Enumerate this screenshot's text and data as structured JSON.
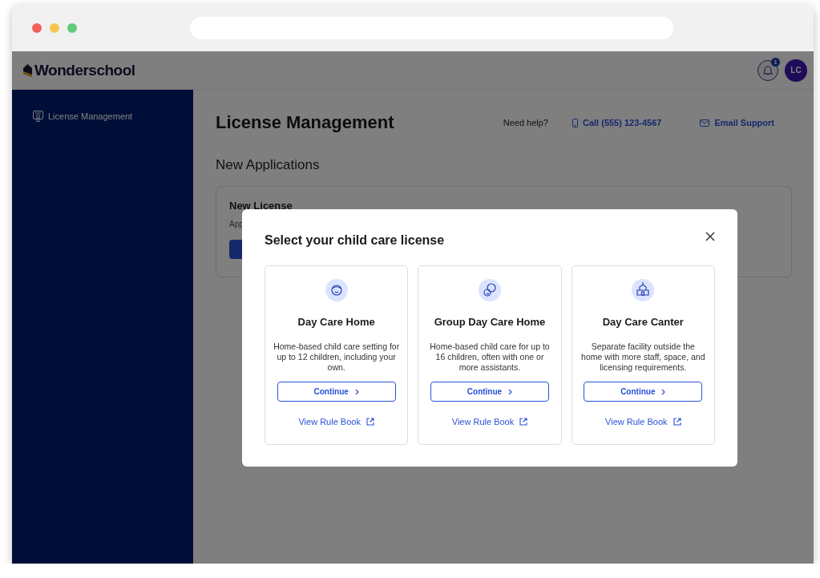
{
  "app_header": {
    "logo": "Wonderschool",
    "notifications": {
      "count": "1"
    },
    "avatar": {
      "initials": "LC"
    }
  },
  "sidebar": {
    "items": [
      {
        "label": "License Management",
        "selected": false
      }
    ]
  },
  "page": {
    "title": "License Management",
    "help": {
      "label": "Need help?",
      "phone": "Call (555) 123-4567",
      "email": "Email Support"
    },
    "section_title": "New Applications",
    "card": {
      "title": "New License",
      "text": "App"
    }
  },
  "modal": {
    "title": "Select your child care license",
    "options": [
      {
        "kind": "child",
        "title": "Day Care Home",
        "description": "Home-based child care setting for up to 12 children, including your own.",
        "button": "Continue",
        "link": "View Rule Book"
      },
      {
        "kind": "group",
        "title": "Group Day Care Home",
        "description": "Home-based child care for up to 16 children, often with one or more assistants.",
        "button": "Continue",
        "link": "View Rule Book"
      },
      {
        "kind": "building",
        "title": "Day Care Canter",
        "description": "Separate facility outside the home with more staff, space, and licensing requirements.",
        "button": "Continue",
        "link": "View Rule Book"
      }
    ]
  }
}
